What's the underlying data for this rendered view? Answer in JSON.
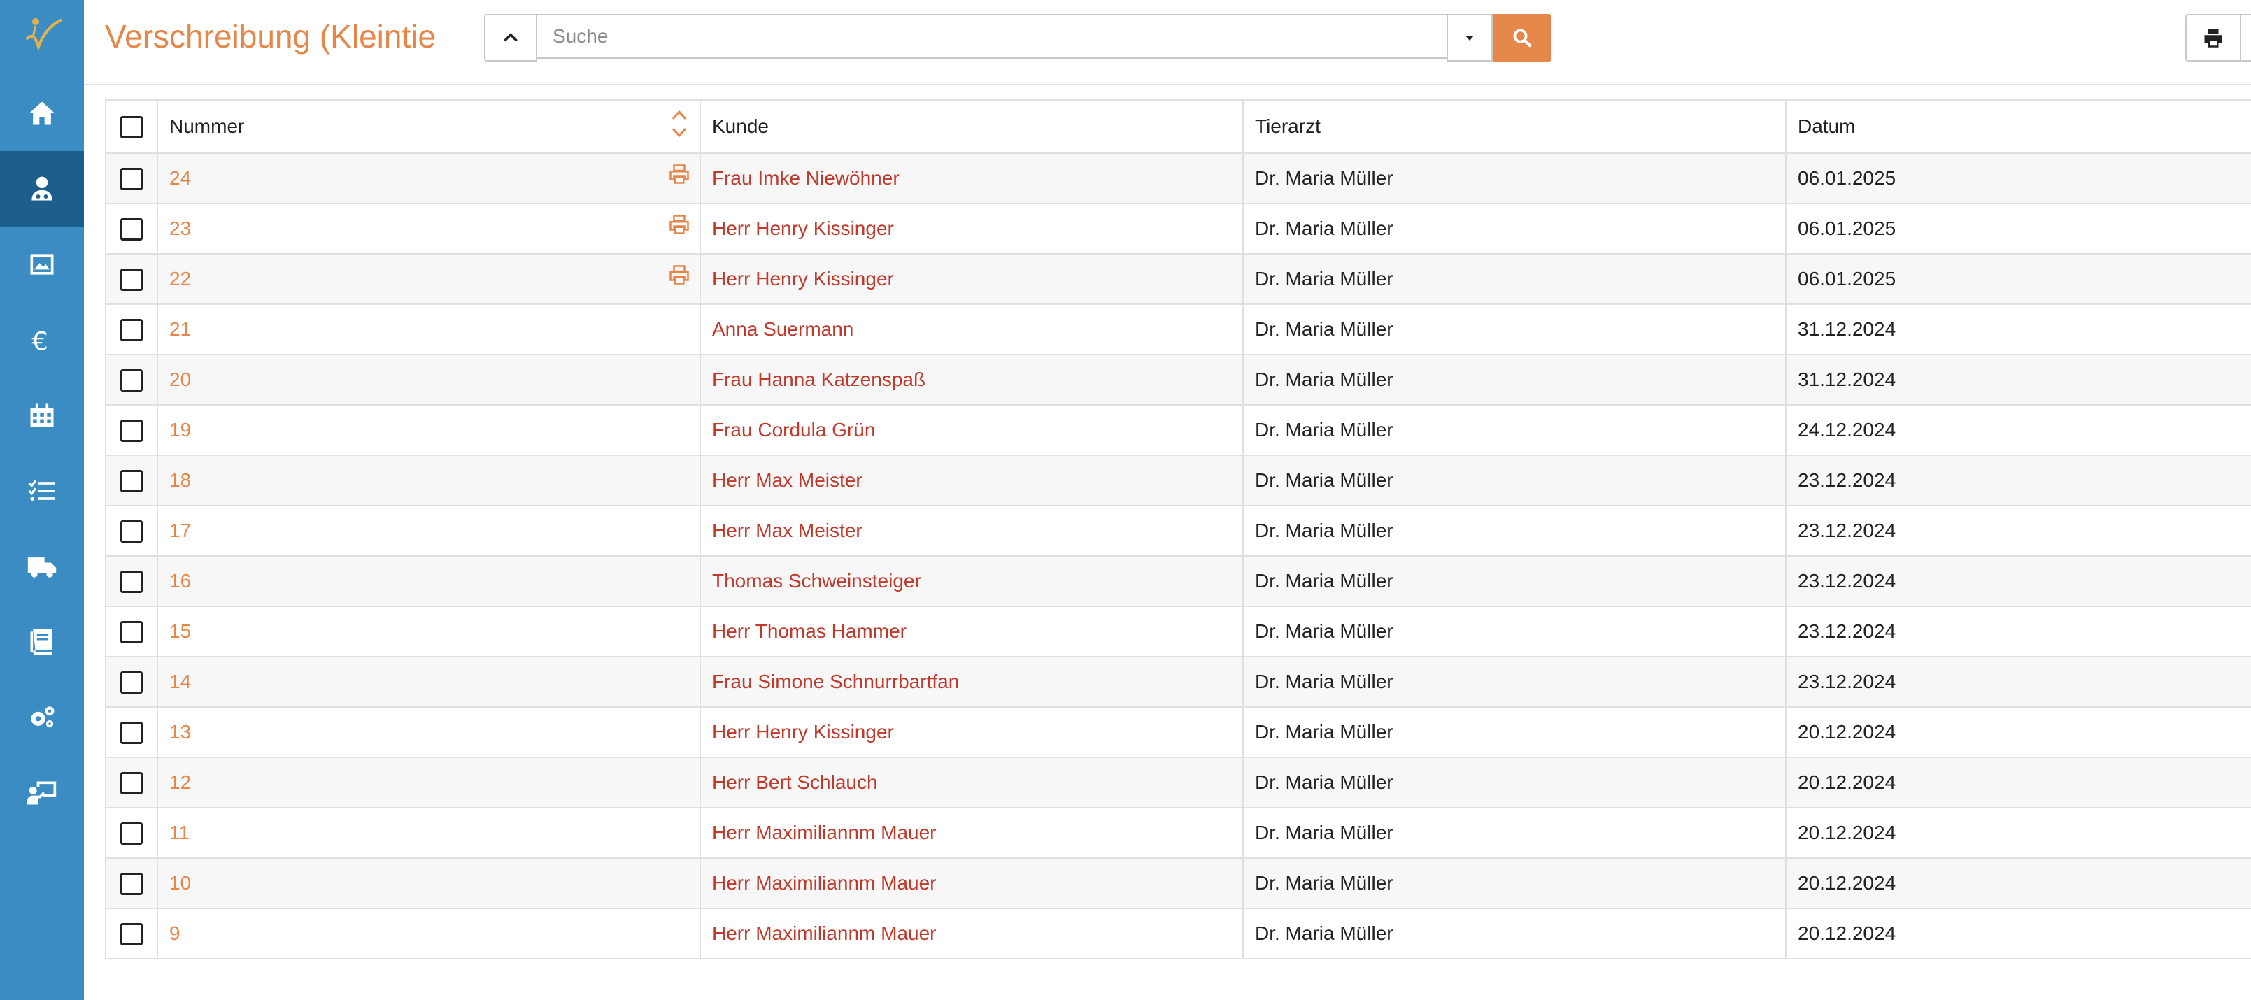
{
  "header": {
    "title": "Verschreibung (Kleintie",
    "search_placeholder": "Suche"
  },
  "sidebar": {
    "items": [
      {
        "icon": "home-icon",
        "active": false
      },
      {
        "icon": "vet-icon",
        "active": true
      },
      {
        "icon": "image-chart-icon",
        "active": false
      },
      {
        "icon": "euro-icon",
        "active": false
      },
      {
        "icon": "calendar-icon",
        "active": false
      },
      {
        "icon": "task-list-icon",
        "active": false
      },
      {
        "icon": "truck-icon",
        "active": false
      },
      {
        "icon": "book-icon",
        "active": false
      },
      {
        "icon": "settings-gears-icon",
        "active": false
      },
      {
        "icon": "presentation-user-icon",
        "active": false
      }
    ]
  },
  "table": {
    "columns": [
      "Nummer",
      "Kunde",
      "Tierarzt",
      "Datum"
    ],
    "rows": [
      {
        "nummer": "24",
        "kunde": "Frau Imke Niewöhner",
        "tierarzt": "Dr. Maria Müller",
        "datum": "06.01.2025",
        "printed": true
      },
      {
        "nummer": "23",
        "kunde": "Herr Henry Kissinger",
        "tierarzt": "Dr. Maria Müller",
        "datum": "06.01.2025",
        "printed": true
      },
      {
        "nummer": "22",
        "kunde": "Herr Henry Kissinger",
        "tierarzt": "Dr. Maria Müller",
        "datum": "06.01.2025",
        "printed": true
      },
      {
        "nummer": "21",
        "kunde": "Anna Suermann",
        "tierarzt": "Dr. Maria Müller",
        "datum": "31.12.2024",
        "printed": false
      },
      {
        "nummer": "20",
        "kunde": "Frau Hanna Katzenspaß",
        "tierarzt": "Dr. Maria Müller",
        "datum": "31.12.2024",
        "printed": false
      },
      {
        "nummer": "19",
        "kunde": "Frau Cordula Grün",
        "tierarzt": "Dr. Maria Müller",
        "datum": "24.12.2024",
        "printed": false
      },
      {
        "nummer": "18",
        "kunde": "Herr Max Meister",
        "tierarzt": "Dr. Maria Müller",
        "datum": "23.12.2024",
        "printed": false
      },
      {
        "nummer": "17",
        "kunde": "Herr Max Meister",
        "tierarzt": "Dr. Maria Müller",
        "datum": "23.12.2024",
        "printed": false
      },
      {
        "nummer": "16",
        "kunde": "Thomas Schweinsteiger",
        "tierarzt": "Dr. Maria Müller",
        "datum": "23.12.2024",
        "printed": false
      },
      {
        "nummer": "15",
        "kunde": "Herr Thomas Hammer",
        "tierarzt": "Dr. Maria Müller",
        "datum": "23.12.2024",
        "printed": false
      },
      {
        "nummer": "14",
        "kunde": "Frau Simone Schnurrbartfan",
        "tierarzt": "Dr. Maria Müller",
        "datum": "23.12.2024",
        "printed": false
      },
      {
        "nummer": "13",
        "kunde": "Herr Henry Kissinger",
        "tierarzt": "Dr. Maria Müller",
        "datum": "20.12.2024",
        "printed": false
      },
      {
        "nummer": "12",
        "kunde": "Herr Bert Schlauch",
        "tierarzt": "Dr. Maria Müller",
        "datum": "20.12.2024",
        "printed": false
      },
      {
        "nummer": "11",
        "kunde": "Herr Maximiliannm Mauer",
        "tierarzt": "Dr. Maria Müller",
        "datum": "20.12.2024",
        "printed": false
      },
      {
        "nummer": "10",
        "kunde": "Herr Maximiliannm Mauer",
        "tierarzt": "Dr. Maria Müller",
        "datum": "20.12.2024",
        "printed": false
      },
      {
        "nummer": "9",
        "kunde": "Herr Maximiliannm Mauer",
        "tierarzt": "Dr. Maria Müller",
        "datum": "20.12.2024",
        "printed": false
      }
    ]
  },
  "colors": {
    "sidebar": "#3a8cc2",
    "sidebar_active": "#1d5f8c",
    "accent": "#e6874a",
    "customer_link": "#c0392b"
  }
}
